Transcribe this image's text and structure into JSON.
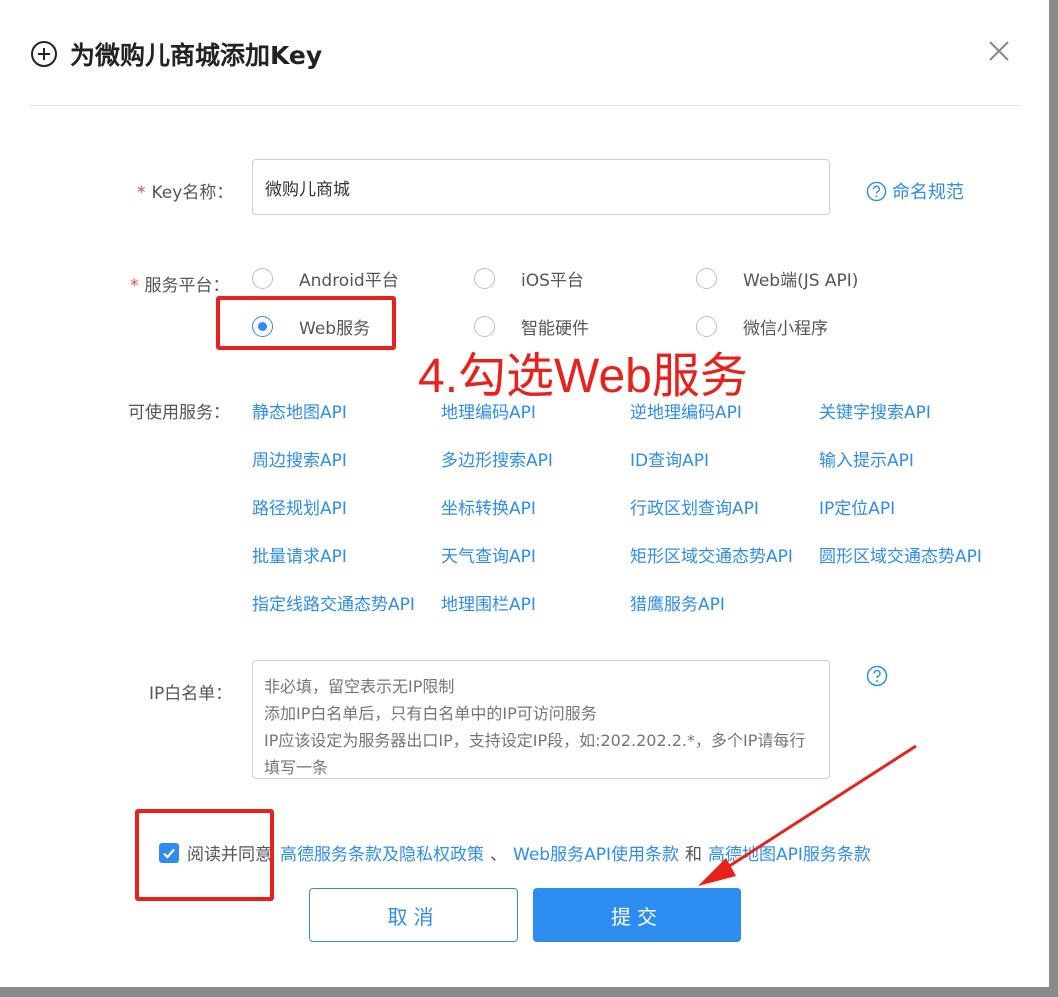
{
  "dialog": {
    "title": "为微购儿商城添加Key"
  },
  "form": {
    "key_name": {
      "label": "Key名称：",
      "value": "微购儿商城",
      "help_text": "命名规范"
    },
    "platform": {
      "label": "服务平台：",
      "options": [
        {
          "label": "Android平台",
          "selected": false
        },
        {
          "label": "iOS平台",
          "selected": false
        },
        {
          "label": "Web端(JS API)",
          "selected": false
        },
        {
          "label": "Web服务",
          "selected": true
        },
        {
          "label": "智能硬件",
          "selected": false
        },
        {
          "label": "微信小程序",
          "selected": false
        }
      ]
    },
    "services": {
      "label": "可使用服务：",
      "items": [
        "静态地图API",
        "地理编码API",
        "逆地理编码API",
        "关键字搜索API",
        "周边搜索API",
        "多边形搜索API",
        "ID查询API",
        "输入提示API",
        "路径规划API",
        "坐标转换API",
        "行政区划查询API",
        "IP定位API",
        "批量请求API",
        "天气查询API",
        "矩形区域交通态势API",
        "圆形区域交通态势API",
        "指定线路交通态势API",
        "地理围栏API",
        "猎鹰服务API"
      ]
    },
    "ip_whitelist": {
      "label": "IP白名单：",
      "placeholder": "非必填，留空表示无IP限制\n添加IP白名单后，只有白名单中的IP可访问服务\nIP应该设定为服务器出口IP，支持设定IP段，如:202.202.2.*，多个IP请每行填写一条"
    },
    "agreement": {
      "checked": true,
      "prefix": "阅读并同意",
      "link1": "高德服务条款及隐私权政策",
      "sep1": "、",
      "link2": "Web服务API使用条款",
      "sep2": "和",
      "link3": "高德地图API服务条款"
    }
  },
  "buttons": {
    "cancel": "取消",
    "submit": "提交"
  },
  "annotation": {
    "text": "4.勾选Web服务",
    "color": "#e8211b"
  },
  "colors": {
    "accent": "#2d8cf0",
    "required": "#e6484a"
  }
}
